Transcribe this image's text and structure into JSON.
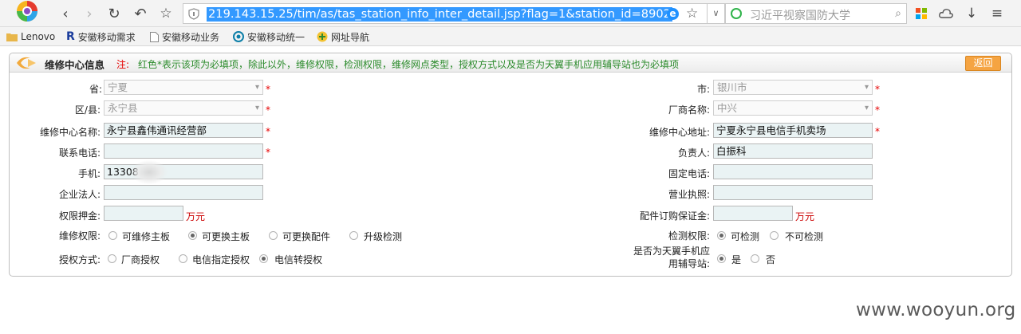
{
  "browser": {
    "url": "219.143.15.25/tim/as/tas_station_info_inter_detail.jsp?flag=1&station_id=8902",
    "search_placeholder": "习近平视察国防大学",
    "bookmarks": [
      {
        "label": "Lenovo",
        "icon": "folder-icon"
      },
      {
        "label": "安徽移动需求",
        "icon": "r-icon"
      },
      {
        "label": "安徽移动业务",
        "icon": "page-icon"
      },
      {
        "label": "安徽移动统一",
        "icon": "swirl-icon"
      },
      {
        "label": "网址导航",
        "icon": "nav-icon"
      }
    ]
  },
  "panel": {
    "title": "维修中心信息",
    "note_label": "注:",
    "note": "红色*表示该项为必填项，除此以外，维修权限，检测权限，维修网点类型，授权方式以及是否为天翼手机应用辅导站也为必填项",
    "back_label": "返回"
  },
  "form": {
    "required_mark": "*",
    "unit": "万元",
    "province": {
      "label": "省:",
      "value": "宁夏"
    },
    "city": {
      "label": "市:",
      "value": "银川市"
    },
    "county": {
      "label": "区/县:",
      "value": "永宁县"
    },
    "vendor": {
      "label": "厂商名称:",
      "value": "中兴"
    },
    "center_name": {
      "label": "维修中心名称:",
      "value": "永宁县鑫伟通讯经营部"
    },
    "center_address": {
      "label": "维修中心地址:",
      "value": "宁夏永宁县电信手机卖场"
    },
    "contact_phone": {
      "label": "联系电话:",
      "value": ""
    },
    "manager": {
      "label": "负责人:",
      "value": "白振科"
    },
    "mobile": {
      "label": "手机:",
      "value": "13308"
    },
    "landline": {
      "label": "固定电话:",
      "value": ""
    },
    "legal_person": {
      "label": "企业法人:",
      "value": ""
    },
    "business_license": {
      "label": "营业执照:",
      "value": ""
    },
    "deposit": {
      "label": "权限押金:",
      "value": ""
    },
    "parts_deposit": {
      "label": "配件订购保证金:",
      "value": ""
    },
    "repair_rights": {
      "label": "维修权限:",
      "options": [
        "可维修主板",
        "可更换主板",
        "可更换配件",
        "升级检测"
      ],
      "selected": "可更换主板"
    },
    "test_rights": {
      "label": "检测权限:",
      "options": [
        "可检测",
        "不可检测"
      ],
      "selected": "可检测"
    },
    "auth_mode": {
      "label": "授权方式:",
      "options": [
        "厂商授权",
        "电信指定授权",
        "电信转授权"
      ],
      "selected": "电信转授权"
    },
    "tianyi_station": {
      "label_line1": "是否为天翼手机应",
      "label_line2": "用辅导站:",
      "options": [
        "是",
        "否"
      ],
      "selected": "是"
    }
  },
  "watermark": "www.wooyun.org"
}
